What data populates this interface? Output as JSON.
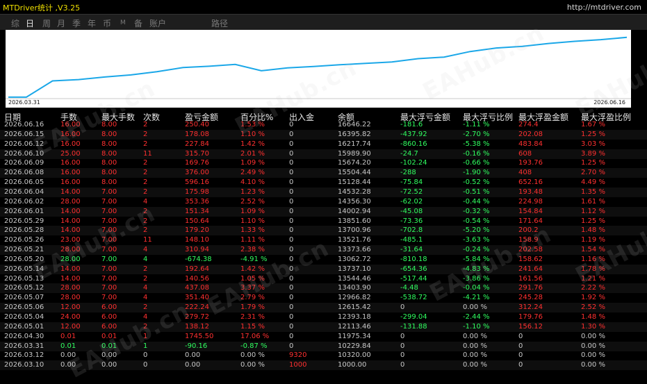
{
  "app": {
    "title": "MTDriver统计 ,V3.25",
    "url": "http://mtdriver.com"
  },
  "tabs": [
    {
      "label": "综",
      "active": false
    },
    {
      "label": "日",
      "active": true
    },
    {
      "label": "周",
      "active": false
    },
    {
      "label": "月",
      "active": false
    },
    {
      "label": "季",
      "active": false
    },
    {
      "label": "年",
      "active": false
    },
    {
      "label": "币",
      "active": false
    },
    {
      "label": "M",
      "active": false
    },
    {
      "label": "备",
      "active": false
    },
    {
      "label": "账户",
      "active": false
    },
    {
      "label": "路径",
      "active": false
    }
  ],
  "chart_data": {
    "type": "line",
    "x_start_label": "2026.03.31",
    "x_end_label": "2026.06.16",
    "line_color": "#1aa7e8",
    "y": [
      10229.84,
      10229.84,
      11975.34,
      12113.46,
      12393.18,
      12615.42,
      12966.82,
      13403.9,
      13544.46,
      13737.1,
      13062.72,
      13373.66,
      13521.76,
      13700.96,
      13851.6,
      14002.94,
      14356.3,
      14532.28,
      15128.44,
      15504.44,
      15674.2,
      15989.9,
      16217.74,
      16395.82,
      16646.22
    ]
  },
  "watermark": "EAHub.cn",
  "table": {
    "headers": [
      "日期",
      "手数",
      "最大手数",
      "次数",
      "盈亏金额",
      "百分比%",
      "出入金",
      "余额",
      "最大浮亏金额",
      "最大浮亏比例",
      "最大浮盈金额",
      "最大浮盈比例"
    ],
    "rows": [
      [
        "2026.06.16",
        "16.00",
        "8.00",
        "2",
        "250.40",
        "1.53 %",
        "0",
        "16646.22",
        "-181.6",
        "-1.11 %",
        "274.4",
        "1.67 %"
      ],
      [
        "2026.06.15",
        "16.00",
        "8.00",
        "2",
        "178.08",
        "1.10 %",
        "0",
        "16395.82",
        "-437.92",
        "-2.70 %",
        "202.08",
        "1.25 %"
      ],
      [
        "2026.06.12",
        "16.00",
        "8.00",
        "2",
        "227.84",
        "1.42 %",
        "0",
        "16217.74",
        "-860.16",
        "-5.38 %",
        "483.84",
        "3.03 %"
      ],
      [
        "2026.06.10",
        "25.00",
        "8.00",
        "11",
        "315.70",
        "2.01 %",
        "0",
        "15989.90",
        "-24.7",
        "-0.16 %",
        "608",
        "3.89 %"
      ],
      [
        "2026.06.09",
        "16.00",
        "8.00",
        "2",
        "169.76",
        "1.09 %",
        "0",
        "15674.20",
        "-102.24",
        "-0.66 %",
        "193.76",
        "1.25 %"
      ],
      [
        "2026.06.08",
        "16.00",
        "8.00",
        "2",
        "376.00",
        "2.49 %",
        "0",
        "15504.44",
        "-288",
        "-1.90 %",
        "408",
        "2.70 %"
      ],
      [
        "2026.06.05",
        "16.00",
        "8.00",
        "2",
        "596.16",
        "4.10 %",
        "0",
        "15128.44",
        "-75.84",
        "-0.52 %",
        "652.16",
        "4.49 %"
      ],
      [
        "2026.06.04",
        "14.00",
        "7.00",
        "2",
        "175.98",
        "1.23 %",
        "0",
        "14532.28",
        "-72.52",
        "-0.51 %",
        "193.48",
        "1.35 %"
      ],
      [
        "2026.06.02",
        "28.00",
        "7.00",
        "4",
        "353.36",
        "2.52 %",
        "0",
        "14356.30",
        "-62.02",
        "-0.44 %",
        "224.98",
        "1.61 %"
      ],
      [
        "2026.06.01",
        "14.00",
        "7.00",
        "2",
        "151.34",
        "1.09 %",
        "0",
        "14002.94",
        "-45.08",
        "-0.32 %",
        "154.84",
        "1.12 %"
      ],
      [
        "2026.05.29",
        "14.00",
        "7.00",
        "2",
        "150.64",
        "1.10 %",
        "0",
        "13851.60",
        "-73.36",
        "-0.54 %",
        "171.64",
        "1.25 %"
      ],
      [
        "2026.05.28",
        "14.00",
        "7.00",
        "2",
        "179.20",
        "1.33 %",
        "0",
        "13700.96",
        "-702.8",
        "-5.20 %",
        "200.2",
        "1.48 %"
      ],
      [
        "2026.05.26",
        "23.00",
        "7.00",
        "11",
        "148.10",
        "1.11 %",
        "0",
        "13521.76",
        "-485.1",
        "-3.63 %",
        "158.9",
        "1.19 %"
      ],
      [
        "2026.05.21",
        "28.00",
        "7.00",
        "4",
        "310.94",
        "2.38 %",
        "0",
        "13373.66",
        "-31.64",
        "-0.24 %",
        "202.58",
        "1.54 %"
      ],
      [
        "2026.05.20",
        "28.00",
        "7.00",
        "4",
        "-674.38",
        "-4.91 %",
        "0",
        "13062.72",
        "-810.18",
        "-5.84 %",
        "158.62",
        "1.16 %"
      ],
      [
        "2026.05.14",
        "14.00",
        "7.00",
        "2",
        "192.64",
        "1.42 %",
        "0",
        "13737.10",
        "-654.36",
        "-4.83 %",
        "241.64",
        "1.78 %"
      ],
      [
        "2026.05.13",
        "14.00",
        "7.00",
        "2",
        "140.56",
        "1.05 %",
        "0",
        "13544.46",
        "-517.44",
        "-3.86 %",
        "161.56",
        "1.21 %"
      ],
      [
        "2026.05.12",
        "28.00",
        "7.00",
        "4",
        "437.08",
        "3.37 %",
        "0",
        "13403.90",
        "-4.48",
        "-0.04 %",
        "291.76",
        "2.22 %"
      ],
      [
        "2026.05.07",
        "28.00",
        "7.00",
        "4",
        "351.40",
        "2.79 %",
        "0",
        "12966.82",
        "-538.72",
        "-4.21 %",
        "245.28",
        "1.92 %"
      ],
      [
        "2026.05.06",
        "12.00",
        "6.00",
        "2",
        "222.24",
        "1.79 %",
        "0",
        "12615.42",
        "0",
        "0.00 %",
        "312.24",
        "2.52 %"
      ],
      [
        "2026.05.04",
        "24.00",
        "6.00",
        "4",
        "279.72",
        "2.31 %",
        "0",
        "12393.18",
        "-299.04",
        "-2.44 %",
        "179.76",
        "1.48 %"
      ],
      [
        "2026.05.01",
        "12.00",
        "6.00",
        "2",
        "138.12",
        "1.15 %",
        "0",
        "12113.46",
        "-131.88",
        "-1.10 %",
        "156.12",
        "1.30 %"
      ],
      [
        "2026.04.30",
        "0.01",
        "0.01",
        "1",
        "1745.50",
        "17.06 %",
        "0",
        "11975.34",
        "0",
        "0.00 %",
        "0",
        "0.00 %"
      ],
      [
        "2026.03.31",
        "0.01",
        "0.01",
        "1",
        "-90.16",
        "-0.87 %",
        "0",
        "10229.84",
        "0",
        "0.00 %",
        "0",
        "0.00 %"
      ],
      [
        "2026.03.12",
        "0.00",
        "0.00",
        "0",
        "0.00",
        "0.00 %",
        "9320",
        "10320.00",
        "0",
        "0.00 %",
        "0",
        "0.00 %"
      ],
      [
        "2026.03.10",
        "0.00",
        "0.00",
        "0",
        "0.00",
        "0.00 %",
        "1000",
        "1000.00",
        "0",
        "0.00 %",
        "0",
        "0.00 %"
      ]
    ],
    "colors": {
      "gray": "#c8c8c8",
      "red": "#ff3030",
      "green": "#30ff60",
      "white": "#e6e6e6",
      "row_alt": "#0e0e0e"
    }
  }
}
